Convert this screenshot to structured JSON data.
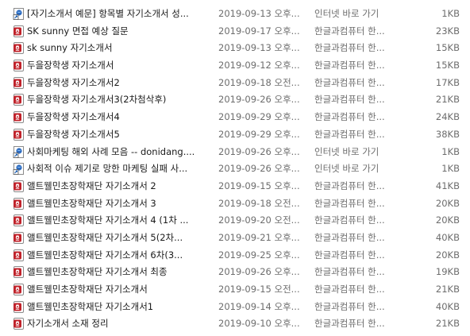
{
  "files": [
    {
      "name": "[자기소개서 예문] 항목별 자기소개서 성...",
      "date": "2019-09-13 오후...",
      "type": "인터넷 바로 가기",
      "size": "1KB",
      "icon": "internet-shortcut-icon"
    },
    {
      "name": "SK sunny 면접 예상 질문",
      "date": "2019-09-17 오후...",
      "type": "한글과컴퓨터 한...",
      "size": "23KB",
      "icon": "hwp-document-icon"
    },
    {
      "name": "sk sunny 자기소개서",
      "date": "2019-09-13 오후...",
      "type": "한글과컴퓨터 한...",
      "size": "15KB",
      "icon": "hwp-document-icon"
    },
    {
      "name": "두을장학생 자기소개서",
      "date": "2019-09-12 오후...",
      "type": "한글과컴퓨터 한...",
      "size": "15KB",
      "icon": "hwp-document-icon"
    },
    {
      "name": "두을장학생 자기소개서2",
      "date": "2019-09-18 오전...",
      "type": "한글과컴퓨터 한...",
      "size": "17KB",
      "icon": "hwp-document-icon"
    },
    {
      "name": "두을장학생 자기소개서3(2차첨삭후)",
      "date": "2019-09-26 오후...",
      "type": "한글과컴퓨터 한...",
      "size": "21KB",
      "icon": "hwp-document-icon"
    },
    {
      "name": "두을장학생 자기소개서4",
      "date": "2019-09-29 오후...",
      "type": "한글과컴퓨터 한...",
      "size": "24KB",
      "icon": "hwp-document-icon"
    },
    {
      "name": "두을장학생 자기소개서5",
      "date": "2019-09-29 오후...",
      "type": "한글과컴퓨터 한...",
      "size": "38KB",
      "icon": "hwp-document-icon"
    },
    {
      "name": "사회마케팅 해외 사례 모음 -- donidang....",
      "date": "2019-09-26 오후...",
      "type": "인터넷 바로 가기",
      "size": "1KB",
      "icon": "internet-shortcut-icon"
    },
    {
      "name": "사회적 이슈 제기로 망한 마케팅 실패 사...",
      "date": "2019-09-26 오후...",
      "type": "인터넷 바로 가기",
      "size": "1KB",
      "icon": "internet-shortcut-icon"
    },
    {
      "name": "앨트웰민초장학재단 자기소개서 2",
      "date": "2019-09-15 오후...",
      "type": "한글과컴퓨터 한...",
      "size": "41KB",
      "icon": "hwp-document-icon"
    },
    {
      "name": "앨트웰민초장학재단 자기소개서 3",
      "date": "2019-09-18 오전...",
      "type": "한글과컴퓨터 한...",
      "size": "20KB",
      "icon": "hwp-document-icon"
    },
    {
      "name": "앨트웰민초장학재단 자기소개서 4 (1차 ...",
      "date": "2019-09-20 오전...",
      "type": "한글과컴퓨터 한...",
      "size": "20KB",
      "icon": "hwp-document-icon"
    },
    {
      "name": "앨트웰민초장학재단 자기소개서 5(2차...",
      "date": "2019-09-21 오후...",
      "type": "한글과컴퓨터 한...",
      "size": "40KB",
      "icon": "hwp-document-icon"
    },
    {
      "name": "앨트웰민초장학재단 자기소개서 6차(3...",
      "date": "2019-09-25 오후...",
      "type": "한글과컴퓨터 한...",
      "size": "20KB",
      "icon": "hwp-document-icon"
    },
    {
      "name": "앨트웰민초장학재단 자기소개서 최종",
      "date": "2019-09-26 오후...",
      "type": "한글과컴퓨터 한...",
      "size": "19KB",
      "icon": "hwp-document-icon"
    },
    {
      "name": "앨트웰민초장학재단 자기소개서",
      "date": "2019-09-15 오전...",
      "type": "한글과컴퓨터 한...",
      "size": "21KB",
      "icon": "hwp-document-icon"
    },
    {
      "name": "앨트웰민초장학재단 자기소개서1",
      "date": "2019-09-14 오후...",
      "type": "한글과컴퓨터 한...",
      "size": "40KB",
      "icon": "hwp-document-icon"
    },
    {
      "name": "자기소개서 소재 정리",
      "date": "2019-09-10 오후...",
      "type": "한글과컴퓨터 한...",
      "size": "21KB",
      "icon": "hwp-document-icon"
    }
  ],
  "colors": {
    "hwp_icon": "#c0222a",
    "shortcut_icon": "#2d6bbf"
  }
}
